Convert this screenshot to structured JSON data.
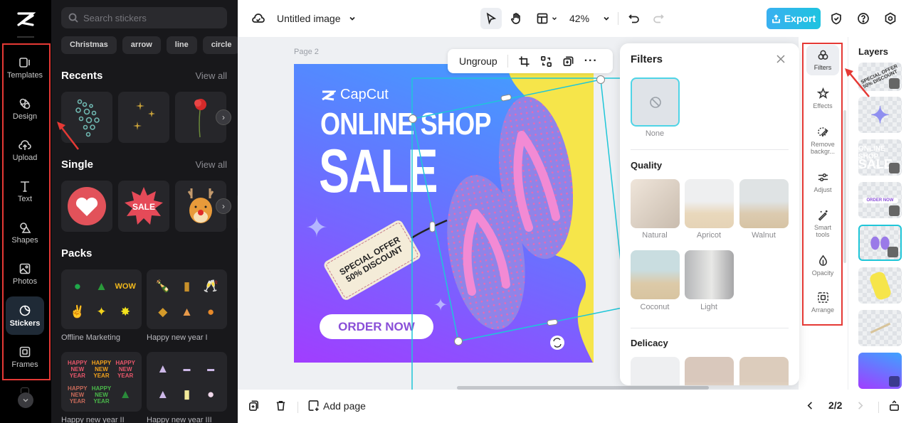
{
  "app": {
    "document_title": "Untitled image",
    "zoom_level": "42%"
  },
  "left_rail": {
    "items": [
      {
        "label": "Templates",
        "icon": "templates-icon"
      },
      {
        "label": "Design",
        "icon": "design-icon"
      },
      {
        "label": "Upload",
        "icon": "upload-icon"
      },
      {
        "label": "Text",
        "icon": "text-icon"
      },
      {
        "label": "Shapes",
        "icon": "shapes-icon"
      },
      {
        "label": "Photos",
        "icon": "photos-icon"
      },
      {
        "label": "Stickers",
        "icon": "stickers-icon",
        "active": true
      },
      {
        "label": "Frames",
        "icon": "frames-icon"
      }
    ]
  },
  "stickers_panel": {
    "search_placeholder": "Search stickers",
    "chips": [
      "Christmas",
      "arrow",
      "line",
      "circle"
    ],
    "recents": {
      "title": "Recents",
      "view_all": "View all",
      "items": [
        "bubbles",
        "sparkles",
        "red poppy"
      ]
    },
    "single": {
      "title": "Single",
      "view_all": "View all",
      "items": [
        "heart",
        "SALE",
        "reindeer"
      ]
    },
    "packs": {
      "title": "Packs",
      "items": [
        {
          "label": "Offline Marketing"
        },
        {
          "label": "Happy new year I"
        },
        {
          "label": "Happy new year II"
        },
        {
          "label": "Happy new year III"
        }
      ]
    }
  },
  "toolbar": {
    "export_label": "Export"
  },
  "canvas": {
    "page_label": "Page 2",
    "floating_toolbar": {
      "ungroup_label": "Ungroup"
    },
    "design": {
      "brand": "CapCut",
      "headline1": "ONLINE SHOP",
      "headline2": "SALE",
      "tag_line1": "SPECIAL OFFER",
      "tag_line2": "50% DISCOUNT",
      "cta": "ORDER NOW"
    }
  },
  "filters_panel": {
    "title": "Filters",
    "none_label": "None",
    "sections": [
      {
        "title": "Quality",
        "items": [
          "Natural",
          "Apricot",
          "Walnut",
          "Coconut",
          "Light"
        ]
      },
      {
        "title": "Delicacy",
        "items": []
      }
    ]
  },
  "tools_strip": {
    "items": [
      "Filters",
      "Effects",
      "Remove backgr...",
      "Adjust",
      "Smart tools",
      "Opacity",
      "Arrange"
    ]
  },
  "layers_panel": {
    "title": "Layers",
    "layers": [
      "Special offer tag",
      "Sparkle",
      "Online shop sale text",
      "Order now button",
      "Flip flops",
      "Yellow blob",
      "Tag string",
      "Background gradient"
    ]
  },
  "bottom_bar": {
    "add_page_label": "Add page",
    "page_indicator": "2/2"
  },
  "colors": {
    "accent": "#1fc6d8",
    "export_gradient_start": "#39b0f0",
    "highlight": "#e53935"
  }
}
